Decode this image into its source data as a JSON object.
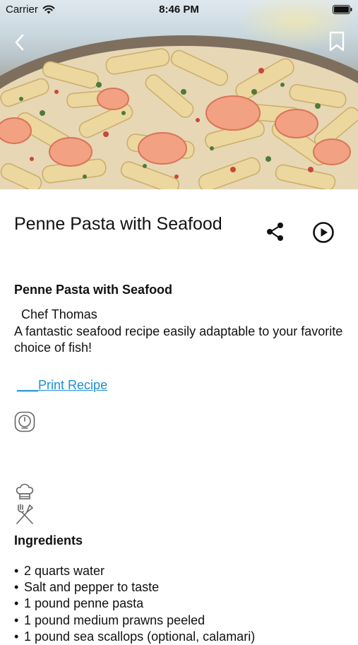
{
  "status_bar": {
    "carrier": "Carrier",
    "time": "8:46 PM"
  },
  "hero": {
    "image_alt": "Penne pasta with shrimp",
    "icons": {
      "back": "chevron-left-icon",
      "bookmark": "bookmark-icon"
    }
  },
  "recipe": {
    "title": "Penne Pasta with Seafood",
    "subtitle": "Penne Pasta with Seafood",
    "chef": "Chef Thomas",
    "description": "A fantastic seafood recipe easily adaptable to your favorite choice of fish!",
    "print_label": "___Print Recipe",
    "icons": {
      "share": "share-icon",
      "play": "play-circle-icon",
      "timer": "timer-icon",
      "chef": "chef-hat-icon",
      "utensils": "fork-knife-icon"
    }
  },
  "ingredients": {
    "heading": "Ingredients",
    "items": [
      "2 quarts water",
      "Salt and pepper to taste",
      "1 pound penne pasta",
      "1 pound medium prawns peeled",
      "1 pound sea scallops (optional, calamari)"
    ]
  },
  "colors": {
    "link": "#1a8fd6",
    "text": "#111111",
    "background": "#ffffff"
  }
}
